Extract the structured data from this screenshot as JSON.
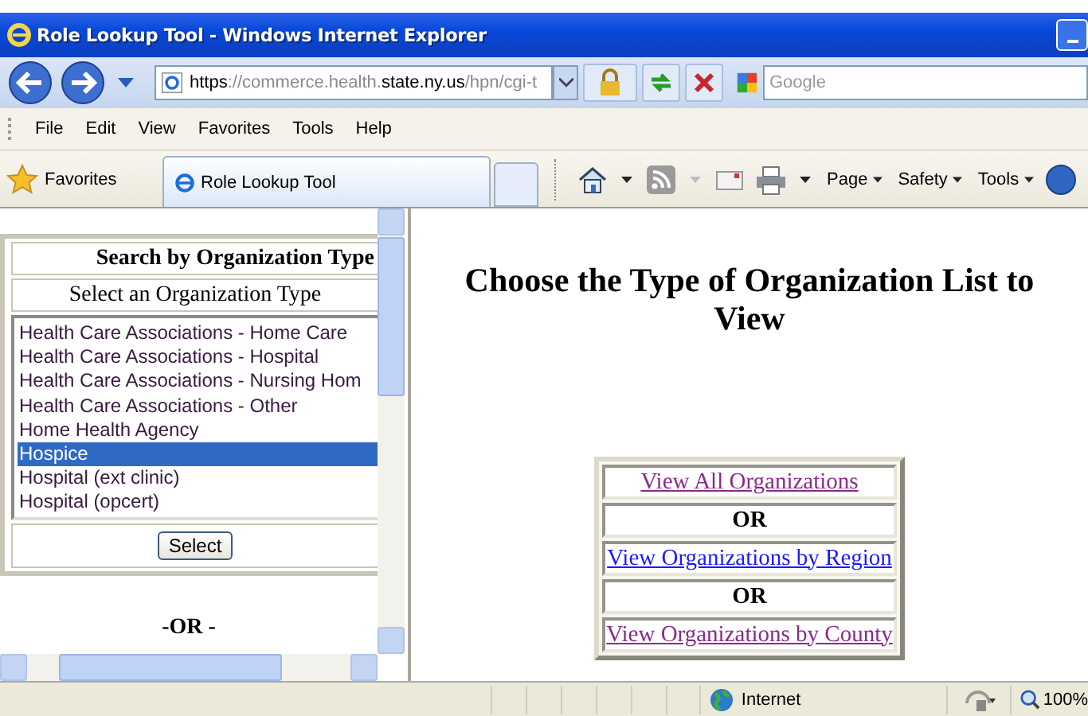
{
  "window": {
    "title": "Role Lookup Tool - Windows Internet Explorer"
  },
  "address": {
    "parts": [
      {
        "text": "https",
        "strong": true
      },
      {
        "text": "://commerce.health.",
        "strong": false
      },
      {
        "text": "state.ny.us",
        "strong": true
      },
      {
        "text": "/hpn/cgi-t",
        "strong": false
      }
    ]
  },
  "search": {
    "placeholder": "Google"
  },
  "menu": [
    "File",
    "Edit",
    "View",
    "Favorites",
    "Tools",
    "Help"
  ],
  "favorites": {
    "label": "Favorites"
  },
  "tabs": [
    {
      "label": "Role Lookup Tool",
      "selected": true
    }
  ],
  "command_bar": [
    "Page",
    "Safety",
    "Tools"
  ],
  "left_frame": {
    "heading": "Search by Organization Type",
    "subheading": "Select an Organization Type",
    "options": [
      {
        "label": "Health Care Associations - Home Care",
        "selected": false
      },
      {
        "label": "Health Care Associations - Hospital",
        "selected": false
      },
      {
        "label": "Health Care Associations - Nursing Hom",
        "selected": false
      },
      {
        "label": "Health Care Associations - Other",
        "selected": false
      },
      {
        "label": "Home Health Agency",
        "selected": false
      },
      {
        "label": "Hospice",
        "selected": true
      },
      {
        "label": "Hospital (ext clinic)",
        "selected": false
      },
      {
        "label": "Hospital (opcert)",
        "selected": false
      }
    ],
    "button": "Select",
    "separator": "-OR -"
  },
  "main": {
    "title": "Choose the Type of Organization List to View",
    "rows": [
      {
        "kind": "link",
        "text": "View All Organizations",
        "visited": true
      },
      {
        "kind": "label",
        "text": "OR"
      },
      {
        "kind": "link",
        "text": "View Organizations by Region",
        "visited": false
      },
      {
        "kind": "label",
        "text": "OR"
      },
      {
        "kind": "link",
        "text": "View Organizations by County",
        "visited": true
      }
    ]
  },
  "status_bar": {
    "zone": "Internet",
    "zoom": "100%"
  }
}
